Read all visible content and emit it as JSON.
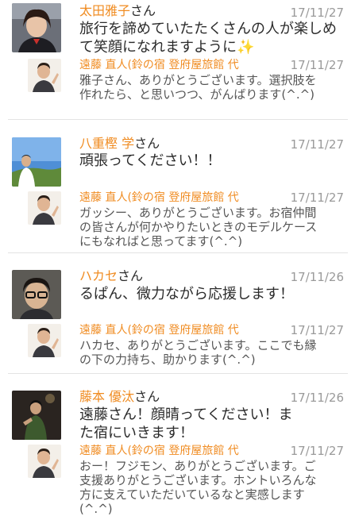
{
  "comments": [
    {
      "name": "太田雅子",
      "honorific": "さん",
      "date": "17/11/27",
      "message": "旅行を諦めていたたくさんの人が楽しめて笑顔になれますように",
      "emoji": "✨",
      "reply": {
        "name": "遠藤 直人(鈴の宿 登府屋旅館 代",
        "date": "17/11/27",
        "message": "雅子さん、ありがとうございます。選択肢を作れたら、と思いつつ、がんばります(^.^)"
      }
    },
    {
      "name": "八重樫 学",
      "honorific": "さん",
      "date": "17/11/27",
      "message": "頑張ってください！！",
      "reply": {
        "name": "遠藤 直人(鈴の宿 登府屋旅館 代",
        "date": "17/11/27",
        "message": "ガッシー、ありがとうございます。お宿仲間の皆さんが何かやりたいときのモデルケースにもなればと思ってます(^.^)"
      }
    },
    {
      "name": "ハカセ",
      "honorific": "さん",
      "date": "17/11/26",
      "message": "るぱん、微力ながら応援します！",
      "reply": {
        "name": "遠藤 直人(鈴の宿 登府屋旅館 代",
        "date": "17/11/27",
        "message": "ハカセ、ありがとうございます。ここでも縁の下の力持ち、助かります(^.^)"
      }
    },
    {
      "name": "藤本 優汰",
      "honorific": "さん",
      "date": "17/11/26",
      "message": "遠藤さん！顔晴ってください！また宿にいきます！",
      "reply": {
        "name": "遠藤 直人(鈴の宿 登府屋旅館 代",
        "date": "17/11/27",
        "message": "おー！フジモン、ありがとうございます。ご支援ありがとうございます。ホントいろんな方に支えていただいているなと実感します(^.^)"
      }
    }
  ],
  "colors": {
    "name": "#f08c22",
    "date": "#9a9a9a",
    "separator": "#e3e3e3"
  }
}
